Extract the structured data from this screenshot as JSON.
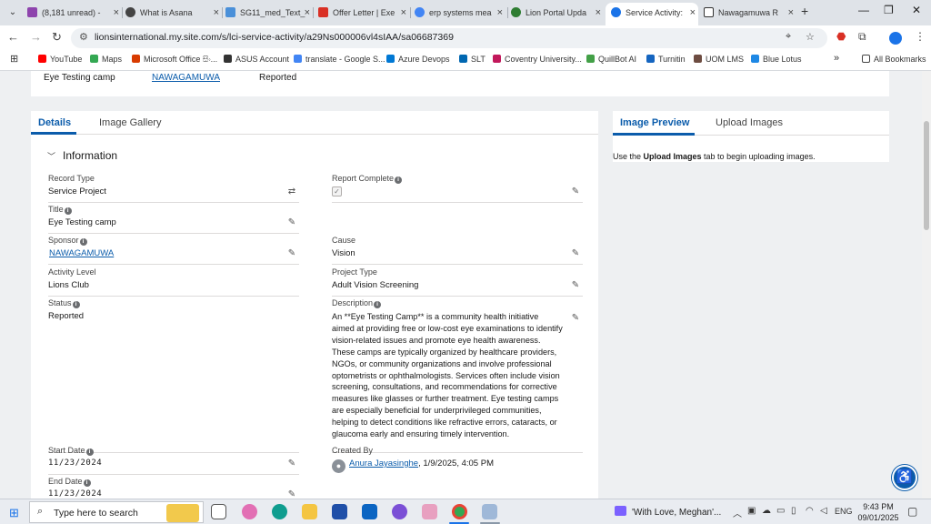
{
  "browser": {
    "tabs": [
      {
        "title": "(8,181 unread) -",
        "color": "#8e44ad"
      },
      {
        "title": "What is Asana",
        "color": "#444444"
      },
      {
        "title": "SG11_med_Text_",
        "color": "#4a90d9"
      },
      {
        "title": "Offer Letter | Exe",
        "color": "#d93025"
      },
      {
        "title": "erp systems mea",
        "color": "#4285f4"
      },
      {
        "title": "Lion Portal Upda",
        "color": "#2e7d32"
      },
      {
        "title": "Service Activity:",
        "color": "#1a73e8"
      },
      {
        "title": "Nawagamuwa R",
        "color": "#333333"
      }
    ],
    "address": "lionsinternational.my.site.com/s/lci-service-activity/a29Ns000006vl4sIAA/sa06687369",
    "bookmarks": [
      {
        "label": "YouTube",
        "color": "#ff0000"
      },
      {
        "label": "Maps",
        "color": "#34a853"
      },
      {
        "label": "Microsoft Office සිං...",
        "color": "#d83b01"
      },
      {
        "label": "ASUS Account",
        "color": "#333333"
      },
      {
        "label": "translate - Google S...",
        "color": "#4285f4"
      },
      {
        "label": "Azure Devops",
        "color": "#0078d4"
      },
      {
        "label": "SLT",
        "color": "#0067b1"
      },
      {
        "label": "Coventry University...",
        "color": "#c2185b"
      },
      {
        "label": "QuillBot AI",
        "color": "#43a047"
      },
      {
        "label": "Turnitin",
        "color": "#1565c0"
      },
      {
        "label": "UOM LMS",
        "color": "#6d4c41"
      },
      {
        "label": "Blue Lotus",
        "color": "#1e88e5"
      }
    ],
    "all_bookmarks": "All Bookmarks"
  },
  "highlights": {
    "title": "Eye Testing camp",
    "sponsor": "NAWAGAMUWA",
    "status": "Reported"
  },
  "left_panel": {
    "tabs": [
      "Details",
      "Image Gallery"
    ],
    "section_title": "Information",
    "fields": {
      "record_type": {
        "label": "Record Type",
        "value": "Service Project"
      },
      "report_complete": {
        "label": "Report Complete",
        "checked": true
      },
      "title": {
        "label": "Title",
        "value": "Eye Testing camp"
      },
      "sponsor": {
        "label": "Sponsor",
        "value": "NAWAGAMUWA"
      },
      "cause": {
        "label": "Cause",
        "value": "Vision"
      },
      "activity_level": {
        "label": "Activity Level",
        "value": "Lions Club"
      },
      "project_type": {
        "label": "Project Type",
        "value": "Adult Vision Screening"
      },
      "status": {
        "label": "Status",
        "value": "Reported"
      },
      "description": {
        "label": "Description",
        "value": "An **Eye Testing Camp** is a community health initiative aimed at providing free or low-cost eye examinations to identify vision-related issues and promote eye health awareness. These camps are typically organized by healthcare providers, NGOs, or community organizations and involve professional optometrists or ophthalmologists. Services often include vision screening, consultations, and recommendations for corrective measures like glasses or further treatment. Eye testing camps are especially beneficial for underprivileged communities, helping to detect conditions like refractive errors, cataracts, or glaucoma early and ensuring timely intervention."
      },
      "start_date": {
        "label": "Start Date",
        "value": "11/23/2024"
      },
      "created_by": {
        "label": "Created By",
        "name": "Anura Jayasinghe",
        "date": ", 1/9/2025, 4:05 PM"
      },
      "end_date": {
        "label": "End Date",
        "value": "11/23/2024"
      }
    }
  },
  "right_panel": {
    "tabs": [
      "Image Preview",
      "Upload Images"
    ],
    "hint_prefix": "Use the ",
    "hint_bold": "Upload Images",
    "hint_suffix": " tab to begin uploading images."
  },
  "taskbar": {
    "search_placeholder": "Type here to search",
    "media_title": "'With Love, Meghan'...",
    "language": "ENG",
    "time": "9:43 PM",
    "date": "09/01/2025"
  },
  "colors": {
    "brand_blue": "#0b5cab",
    "page_bg": "#eef0f2"
  }
}
